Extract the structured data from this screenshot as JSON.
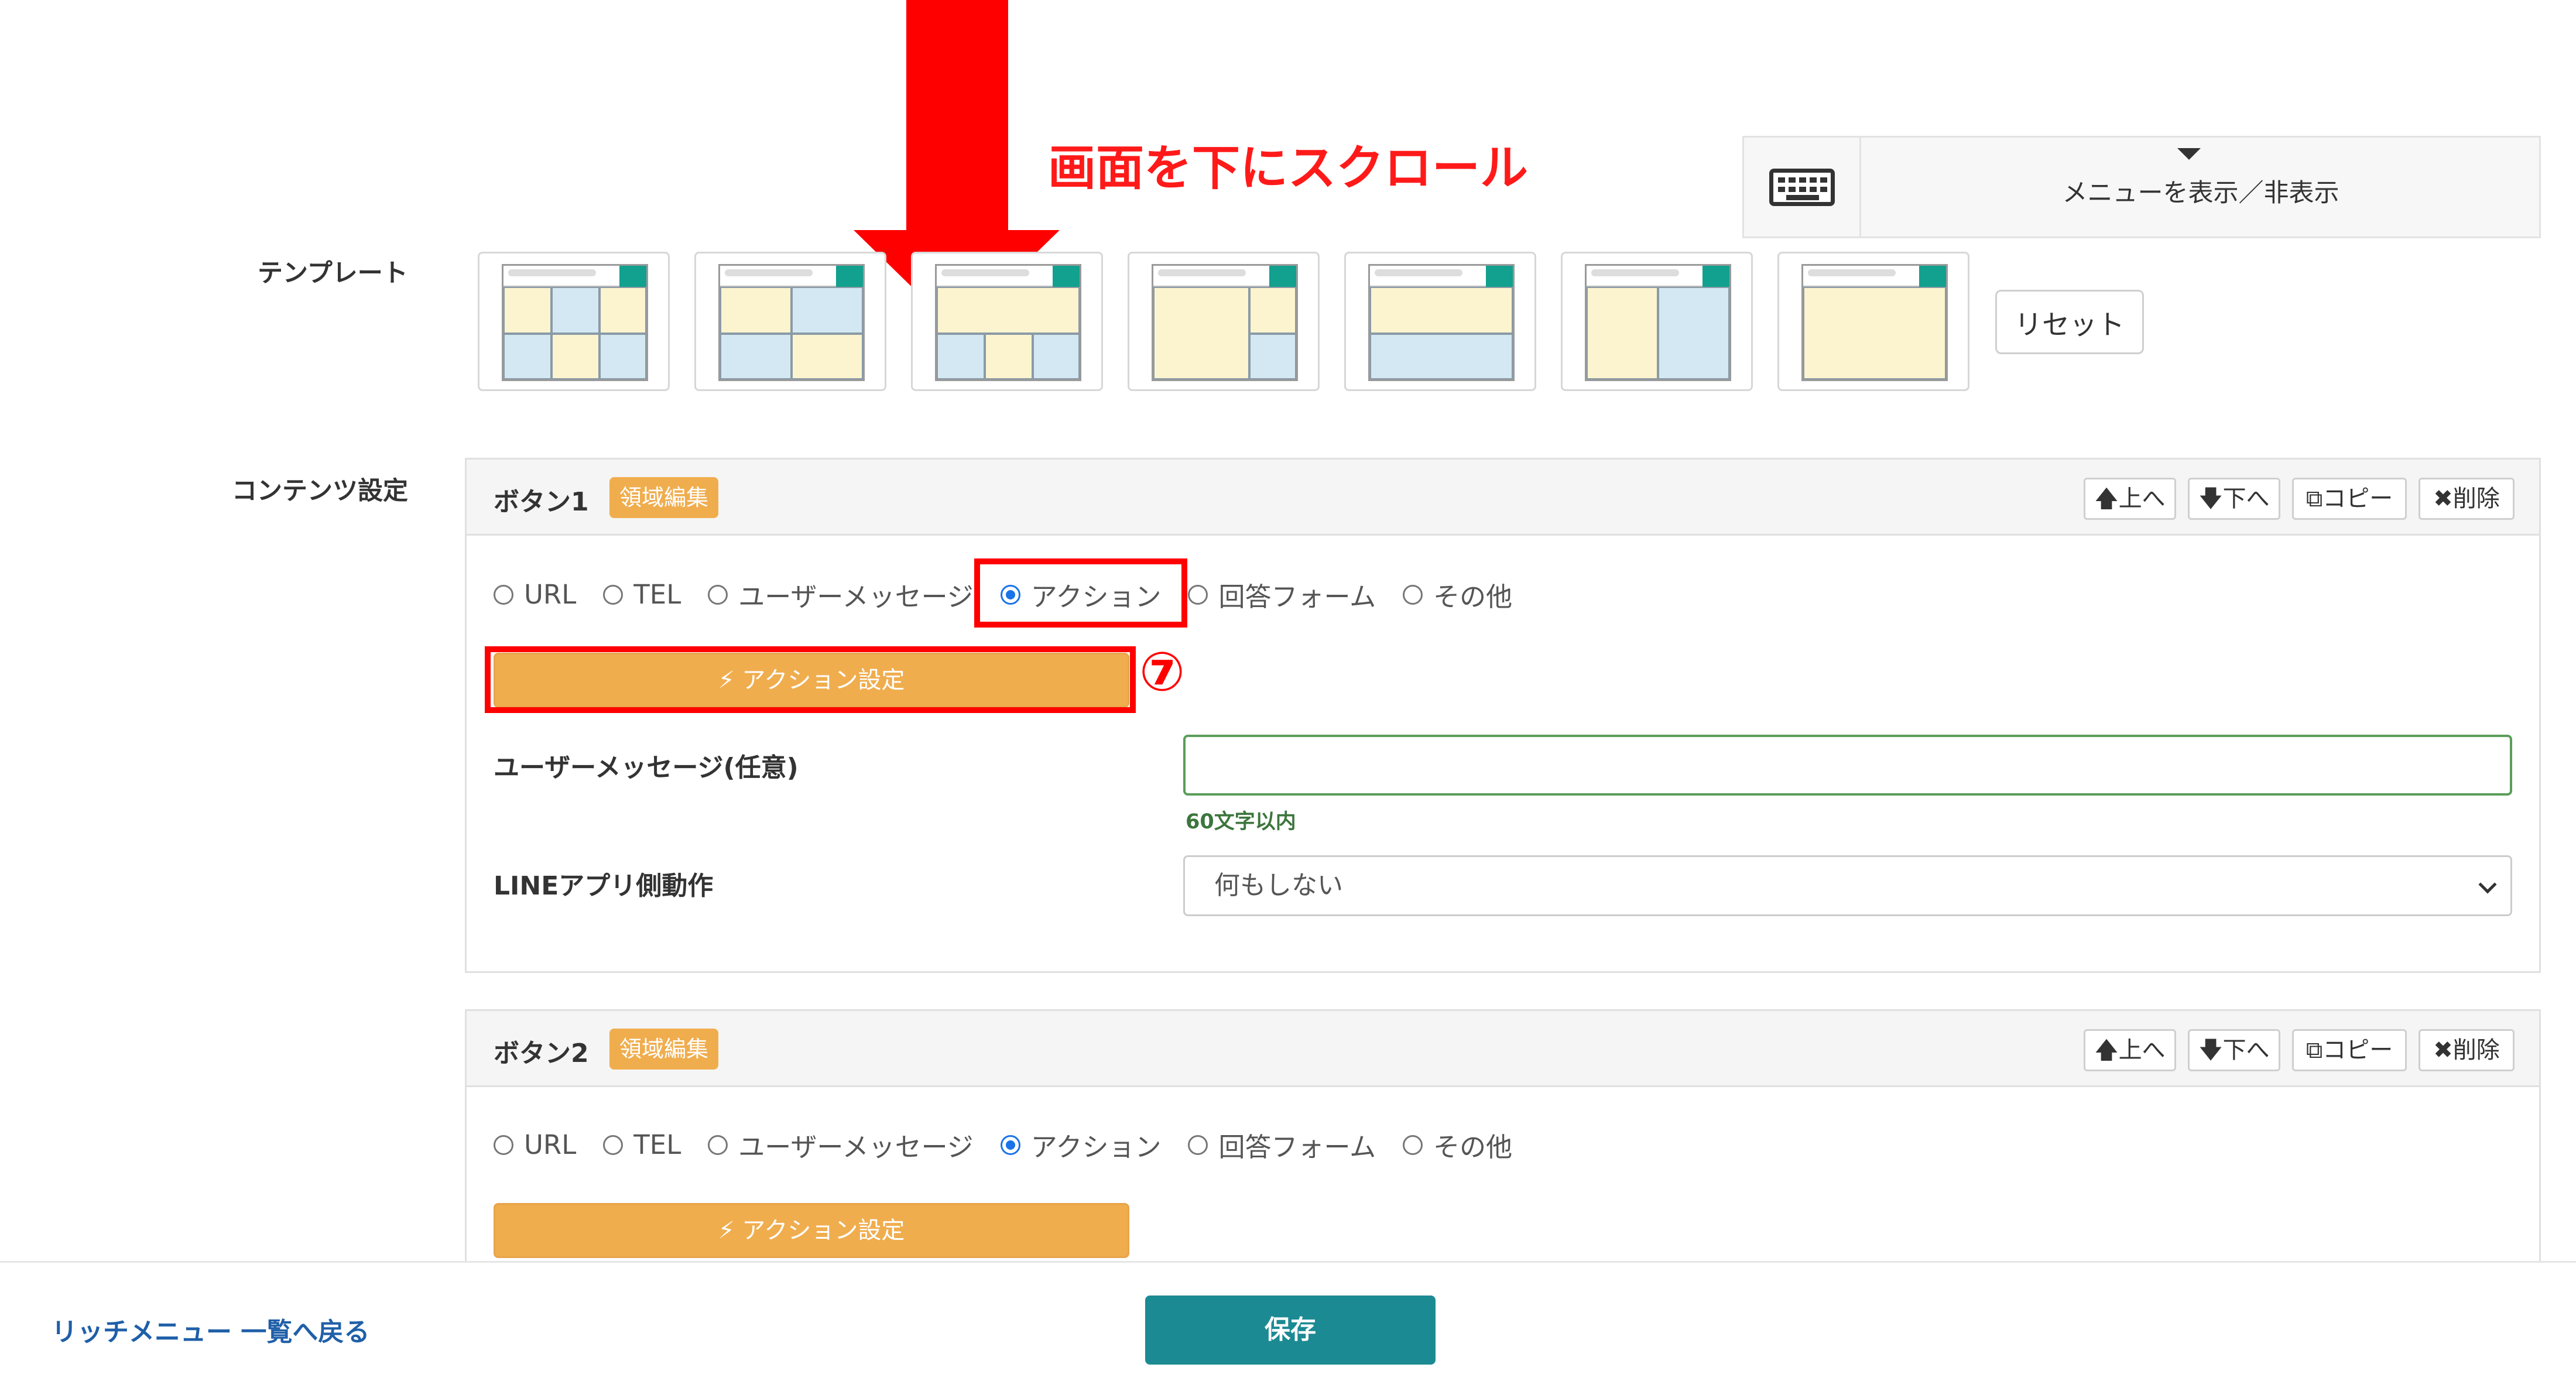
{
  "annotation": {
    "scroll_note": "画面を下にスクロール",
    "step_marker": "⑦",
    "highlight_color": "#ff0000"
  },
  "menu_toggle": {
    "icon": "keyboard-icon",
    "label": "メニューを表示／非表示"
  },
  "template_section": {
    "label": "テンプレート",
    "reset_label": "リセット",
    "template_count": 7
  },
  "content_section": {
    "label": "コンテンツ設定",
    "tools": {
      "up": "上へ",
      "down": "下へ",
      "copy": "コピー",
      "delete": "削除"
    },
    "radio_options": [
      "URL",
      "TEL",
      "ユーザーメッセージ",
      "アクション",
      "回答フォーム",
      "その他"
    ],
    "selected_option": "アクション",
    "buttons": [
      {
        "title": "ボタン1",
        "badge": "領域編集",
        "action_label": "アクション設定",
        "user_message_label": "ユーザーメッセージ(任意)",
        "user_message_value": "",
        "user_message_hint": "60文字以内",
        "line_action_label": "LINEアプリ側動作",
        "line_action_value": "何もしない"
      },
      {
        "title": "ボタン2",
        "badge": "領域編集",
        "action_label": "アクション設定"
      }
    ]
  },
  "footer": {
    "back_link": "リッチメニュー 一覧へ戻る",
    "save_label": "保存"
  },
  "colors": {
    "accent_orange": "#f0ad4e",
    "save_teal": "#1c8a93",
    "radio_blue": "#1a73e8",
    "link_blue": "#1f5fa8"
  }
}
